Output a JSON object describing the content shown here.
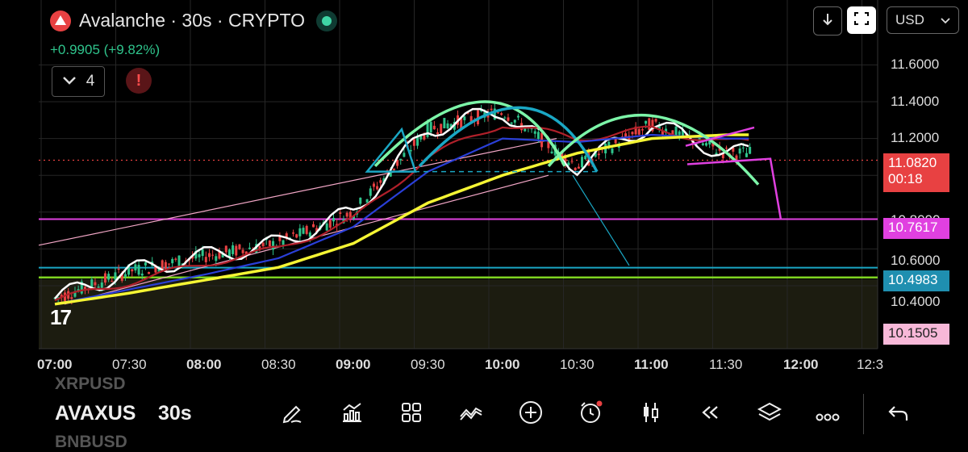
{
  "header": {
    "title": "Avalanche · 30s · CRYPTO",
    "change": "+0.9905 (+9.82%)",
    "indicator_count": "4",
    "alert_symbol": "!"
  },
  "toolbar_top": {
    "currency": "USD"
  },
  "price_axis": {
    "labels": [
      "11.6000",
      "11.4000",
      "11.2000",
      "10.6000",
      "10.4000"
    ],
    "hidden_label": "10.8000",
    "current_price": "11.0820",
    "countdown": "00:18",
    "magenta_level": "10.7617",
    "blue_level": "10.4983",
    "pink_level": "10.1505"
  },
  "time_axis": {
    "labels": [
      "07:00",
      "07:30",
      "08:00",
      "08:30",
      "09:00",
      "09:30",
      "10:00",
      "10:30",
      "11:00",
      "11:30",
      "12:00",
      "12:3"
    ]
  },
  "watermark": "17",
  "bottom": {
    "symbol_above": "XRPUSD",
    "symbol": "AVAXUS",
    "interval": "30s",
    "symbol_below": "BNBUSD"
  },
  "colors": {
    "up": "#2fc48c",
    "down": "#e84142",
    "white_ma": "#ffffff",
    "red_ma": "#b0202a",
    "blue_ma": "#2a3fd8",
    "yellow_ma": "#f5f534",
    "green_arc": "#7cf5a8",
    "teal_arc": "#1aa7c4",
    "magenta": "#e040e0",
    "current_price_badge": "#e84142",
    "level_blue_badge": "#1f8fb0",
    "level_magenta_badge": "#e040e0",
    "level_pink_badge": "#f7b8d8"
  },
  "chart_data": {
    "type": "line",
    "x": [
      "07:00",
      "07:30",
      "08:00",
      "08:30",
      "09:00",
      "09:30",
      "10:00",
      "10:30",
      "11:00",
      "11:30",
      "12:00"
    ],
    "series": [
      {
        "values": [
          10.33,
          10.48,
          10.56,
          10.63,
          10.8,
          11.25,
          11.35,
          11.05,
          11.28,
          11.12,
          null
        ]
      },
      {
        "values": [
          10.32,
          10.42,
          10.52,
          10.6,
          10.76,
          11.1,
          11.28,
          11.2,
          11.25,
          11.18,
          null
        ]
      },
      {
        "values": [
          10.3,
          10.38,
          10.46,
          10.55,
          10.72,
          11.02,
          11.2,
          11.18,
          11.22,
          11.2,
          null
        ]
      },
      {
        "values": [
          10.3,
          10.36,
          10.43,
          10.5,
          10.63,
          10.85,
          11.0,
          11.12,
          11.2,
          11.22,
          null
        ]
      }
    ],
    "horizontal_levels": [
      11.082,
      10.7617,
      10.4983,
      10.1505
    ],
    "ylim": [
      10.25,
      11.7
    ],
    "grid": true
  }
}
